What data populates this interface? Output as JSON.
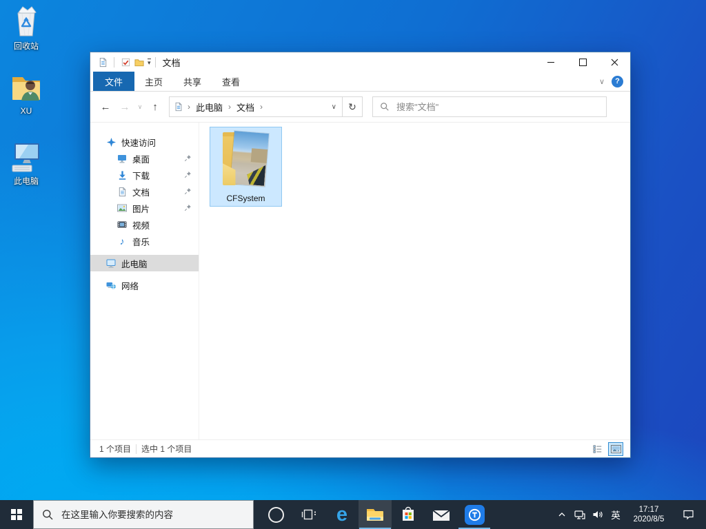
{
  "desktop": {
    "icons": [
      {
        "label": "回收站",
        "icon": "recycle-bin-icon"
      },
      {
        "label": "XU",
        "icon": "user-folder-icon"
      },
      {
        "label": "此电脑",
        "icon": "this-pc-icon"
      }
    ]
  },
  "window": {
    "title": "文档",
    "qat_icons": [
      "window-document-icon",
      "properties-check-icon",
      "new-folder-icon",
      "qat-dropdown-icon"
    ],
    "tabs": [
      {
        "label": "文件",
        "active": true
      },
      {
        "label": "主页",
        "active": false
      },
      {
        "label": "共享",
        "active": false
      },
      {
        "label": "查看",
        "active": false
      }
    ],
    "address": {
      "segments": [
        "此电脑",
        "文档"
      ]
    },
    "search": {
      "placeholder": "搜索\"文档\""
    },
    "sidebar": [
      {
        "label": "快速访问",
        "icon": "quick-access-star-icon",
        "level": 1,
        "pinned": false,
        "selected": false
      },
      {
        "label": "桌面",
        "icon": "desktop-icon",
        "level": 2,
        "pinned": true,
        "selected": false
      },
      {
        "label": "下载",
        "icon": "downloads-icon",
        "level": 2,
        "pinned": true,
        "selected": false
      },
      {
        "label": "文档",
        "icon": "documents-icon",
        "level": 2,
        "pinned": true,
        "selected": false
      },
      {
        "label": "图片",
        "icon": "pictures-icon",
        "level": 2,
        "pinned": true,
        "selected": false
      },
      {
        "label": "视频",
        "icon": "videos-icon",
        "level": 2,
        "pinned": false,
        "selected": false
      },
      {
        "label": "音乐",
        "icon": "music-icon",
        "level": 2,
        "pinned": false,
        "selected": false
      },
      {
        "label": "此电脑",
        "icon": "this-pc-icon",
        "level": 1,
        "pinned": false,
        "selected": true
      },
      {
        "label": "网络",
        "icon": "network-icon",
        "level": 1,
        "pinned": false,
        "selected": false
      }
    ],
    "files": [
      {
        "name": "CFSystem",
        "type": "folder-with-game-thumbnail",
        "selected": true
      }
    ],
    "statusbar": {
      "count": "1 个项目",
      "selection": "选中 1 个项目"
    }
  },
  "taskbar": {
    "search_placeholder": "在这里输入你要搜索的内容",
    "apps": [
      "start",
      "cortana",
      "task-view",
      "edge",
      "file-explorer",
      "store",
      "mail",
      "d-launcher"
    ],
    "running_apps": [
      "file-explorer",
      "d-launcher"
    ],
    "active_app": "file-explorer",
    "tray": {
      "ime": "英",
      "time": "17:17",
      "date": "2020/8/5"
    }
  },
  "glyphs": {
    "arrow_left": "←",
    "arrow_right": "→",
    "arrow_up": "↑",
    "chevron_down": "∨",
    "chevron_right": "›",
    "dropdown": "▾",
    "refresh": "↻",
    "question": "?",
    "edge_e": "e"
  },
  "colors": {
    "file_tab_blue": "#1768b1",
    "selection_bg": "#cce8ff",
    "selection_border": "#8fc8f2",
    "taskbar_bg": "#202c39",
    "desktop_blue_top": "#1c46bd",
    "desktop_cyan_bottom": "#00b2f4",
    "help_badge": "#2b7cd3",
    "active_underline": "#76b9e8"
  }
}
